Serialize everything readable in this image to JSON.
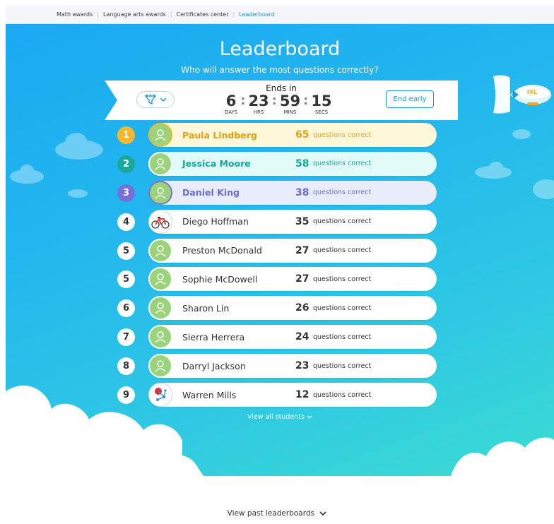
{
  "nav": {
    "items": [
      {
        "label": "Math awards"
      },
      {
        "label": "Language arts awards"
      },
      {
        "label": "Certificates center"
      },
      {
        "label": "Leaderboard"
      }
    ]
  },
  "header": {
    "title": "Leaderboard",
    "subtitle": "Who will answer the most questions correctly?"
  },
  "timer": {
    "ends_in": "Ends in",
    "days": "6",
    "days_label": "DAYS",
    "hrs": "23",
    "hrs_label": "HRS",
    "mins": "59",
    "mins_label": "MINS",
    "secs": "15",
    "secs_label": "SECS"
  },
  "controls": {
    "end_early": "End early",
    "filter_icon": "filter-icon"
  },
  "blimp": {
    "label": "IXL"
  },
  "students": [
    {
      "rank": "1",
      "name": "Paula Lindberg",
      "score": "65",
      "unit": "questions correct",
      "avatar": "person-icon",
      "style": "gold"
    },
    {
      "rank": "2",
      "name": "Jessica Moore",
      "score": "58",
      "unit": "questions correct",
      "avatar": "person-icon",
      "style": "teal"
    },
    {
      "rank": "3",
      "name": "Daniel King",
      "score": "38",
      "unit": "questions correct",
      "avatar": "person-icon",
      "style": "purple"
    },
    {
      "rank": "4",
      "name": "Diego Hoffman",
      "score": "35",
      "unit": "questions correct",
      "avatar": "bicycle-icon",
      "style": "plain"
    },
    {
      "rank": "5",
      "name": "Preston McDonald",
      "score": "27",
      "unit": "questions correct",
      "avatar": "person-icon",
      "style": "plain"
    },
    {
      "rank": "5",
      "name": "Sophie McDowell",
      "score": "27",
      "unit": "questions correct",
      "avatar": "person-icon",
      "style": "plain"
    },
    {
      "rank": "6",
      "name": "Sharon Lin",
      "score": "26",
      "unit": "questions correct",
      "avatar": "person-icon",
      "style": "plain"
    },
    {
      "rank": "7",
      "name": "Sierra Herrera",
      "score": "24",
      "unit": "questions correct",
      "avatar": "person-icon",
      "style": "plain"
    },
    {
      "rank": "8",
      "name": "Darryl Jackson",
      "score": "23",
      "unit": "questions correct",
      "avatar": "person-icon",
      "style": "plain"
    },
    {
      "rank": "9",
      "name": "Warren Mills",
      "score": "12",
      "unit": "questions correct",
      "avatar": "molecule-icon",
      "style": "plain"
    }
  ],
  "footer": {
    "view_all": "View all students",
    "past": "View past leaderboards"
  },
  "colors": {
    "accent": "#1a9bd7",
    "gold": "#f7b72a",
    "teal": "#19a89a",
    "purple": "#7670db"
  }
}
